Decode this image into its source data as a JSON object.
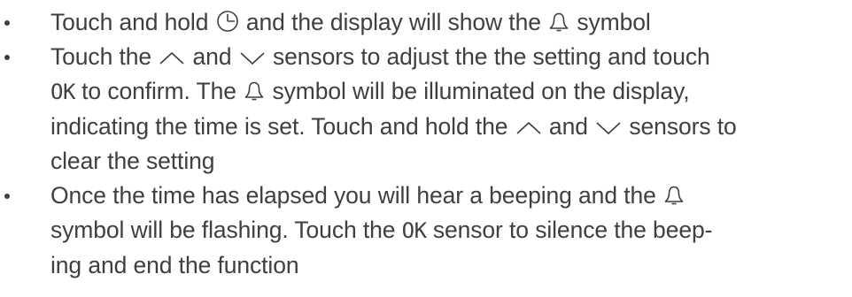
{
  "items": [
    {
      "lines": [
        [
          "Touch and hold ",
          {
            "icon": "clock-icon"
          },
          " and the display will show the ",
          {
            "icon": "bell-icon"
          },
          " symbol"
        ]
      ]
    },
    {
      "lines": [
        [
          "Touch the ",
          {
            "icon": "chevron-up-icon"
          },
          " and ",
          {
            "icon": "chevron-down-icon"
          },
          " sensors to adjust the the setting and touch"
        ],
        [
          {
            "ok": "OK"
          },
          " to confirm. The ",
          {
            "icon": "bell-icon"
          },
          " symbol will be illuminated on the display,"
        ],
        [
          "indicating the time is set. Touch and hold the ",
          {
            "icon": "chevron-up-icon"
          },
          " and ",
          {
            "icon": "chevron-down-icon"
          },
          " sensors to"
        ],
        [
          "clear the setting"
        ]
      ]
    },
    {
      "lines": [
        [
          "Once the time has elapsed you will hear a beeping and the ",
          {
            "icon": "bell-icon"
          }
        ],
        [
          "symbol will be flashing. Touch the ",
          {
            "ok": "OK"
          },
          " sensor to silence the beep-"
        ],
        [
          "ing and end the function"
        ]
      ]
    }
  ]
}
